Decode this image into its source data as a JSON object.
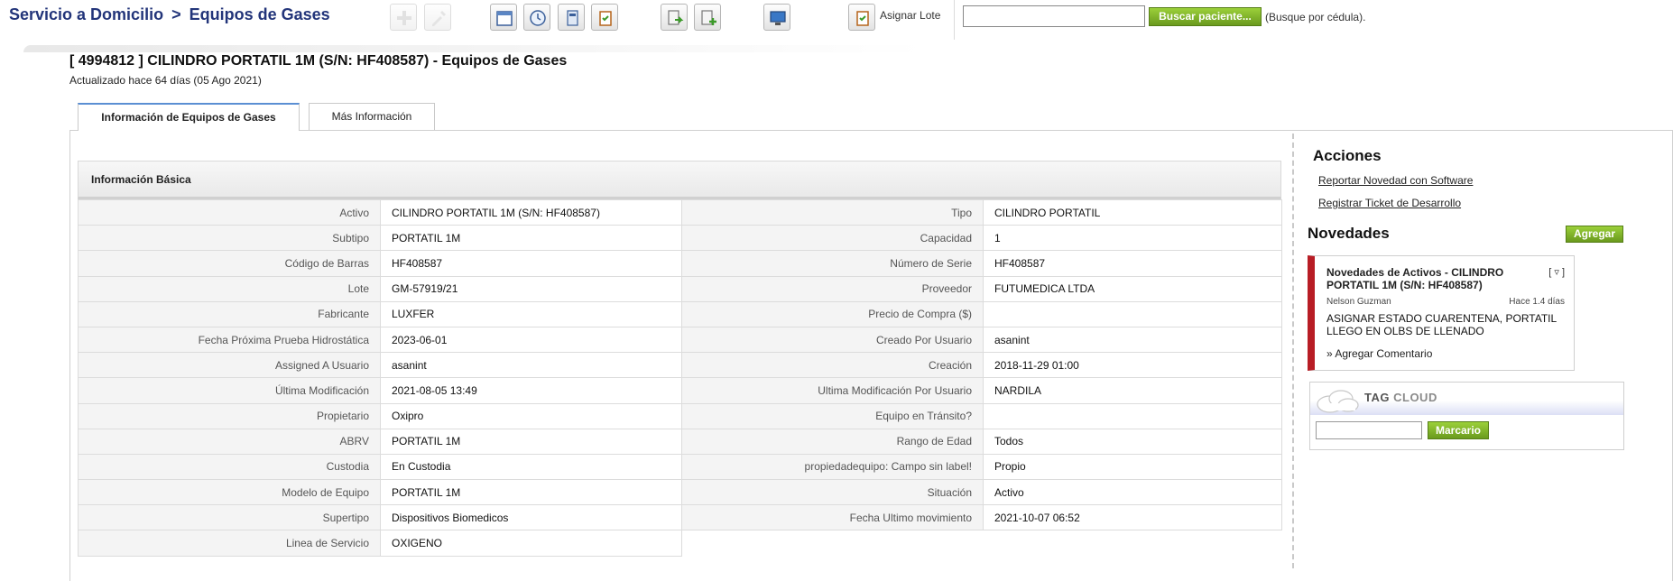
{
  "header": {
    "breadcrumb_root": "Servicio a Domicilio",
    "breadcrumb_sep": ">",
    "breadcrumb_current": "Equipos de Gases"
  },
  "toolbar": {
    "icons": [
      "plus-icon",
      "wrench-icon",
      "calendar-icon",
      "clock-icon",
      "file-icon",
      "clipboard-icon",
      "document-export-icon",
      "document-add-icon",
      "monitor-icon",
      "clipboard-check-icon"
    ],
    "asignar_lote_label": "Asignar Lote"
  },
  "search": {
    "value": "",
    "button_label": "Buscar paciente...",
    "hint": "(Busque por cédula)."
  },
  "record": {
    "title": "[ 4994812 ] CILINDRO PORTATIL 1M (S/N: HF408587) - Equipos de Gases",
    "subtitle": "Actualizado hace 64 días (05 Ago 2021)"
  },
  "tabs": [
    {
      "label": "Información de Equipos de Gases",
      "active": true
    },
    {
      "label": "Más Información",
      "active": false
    }
  ],
  "info": {
    "section_title": "Información Básica",
    "left_rows": [
      {
        "label": "Activo",
        "value": "CILINDRO PORTATIL 1M (S/N: HF408587)"
      },
      {
        "label": "Subtipo",
        "value": "PORTATIL 1M"
      },
      {
        "label": "Código de Barras",
        "value": "HF408587"
      },
      {
        "label": "Lote",
        "value": "GM-57919/21"
      },
      {
        "label": "Fabricante",
        "value": "LUXFER"
      },
      {
        "label": "Fecha Próxima Prueba Hidrostática",
        "value": "2023-06-01"
      },
      {
        "label": "Assigned A Usuario",
        "value": "asanint"
      },
      {
        "label": "Última Modificación",
        "value": "2021-08-05 13:49"
      },
      {
        "label": "Propietario",
        "value": "Oxipro"
      },
      {
        "label": "ABRV",
        "value": "PORTATIL 1M"
      },
      {
        "label": "Custodia",
        "value": "En Custodia"
      },
      {
        "label": "Modelo de Equipo",
        "value": "PORTATIL 1M"
      },
      {
        "label": "Supertipo",
        "value": "Dispositivos Biomedicos"
      },
      {
        "label": "Linea de Servicio",
        "value": "OXIGENO"
      }
    ],
    "right_rows": [
      {
        "label": "Tipo",
        "value": "CILINDRO PORTATIL"
      },
      {
        "label": "Capacidad",
        "value": "1"
      },
      {
        "label": "Número de Serie",
        "value": "HF408587"
      },
      {
        "label": "Proveedor",
        "value": "FUTUMEDICA LTDA"
      },
      {
        "label": "Precio de Compra ($)",
        "value": ""
      },
      {
        "label": "Creado Por Usuario",
        "value": "asanint"
      },
      {
        "label": "Creación",
        "value": "2018-11-29 01:00"
      },
      {
        "label": "Ultima Modificación Por Usuario",
        "value": "NARDILA"
      },
      {
        "label": "Equipo en Tránsito?",
        "value": ""
      },
      {
        "label": "Rango de Edad",
        "value": "Todos"
      },
      {
        "label": "propiedadequipo: Campo sin label!",
        "value": "Propio"
      },
      {
        "label": "Situación",
        "value": "Activo"
      },
      {
        "label": "Fecha Ultimo movimiento",
        "value": "2021-10-07 06:52"
      }
    ]
  },
  "sidebar": {
    "acciones_title": "Acciones",
    "link_reportar": "Reportar Novedad con Software",
    "link_registrar": "Registrar Ticket de Desarrollo",
    "novedades_title": "Novedades",
    "agregar_label": "Agregar",
    "novedad": {
      "title": "Novedades de Activos - CILINDRO PORTATIL 1M (S/N: HF408587)",
      "toggle": "[ ▿ ]",
      "author": "Nelson Guzman",
      "time": "Hace 1.4 días",
      "body": "ASIGNAR ESTADO CUARENTENA, PORTATIL LLEGO EN OLBS DE LLENADO",
      "comment_link": "» Agregar Comentario"
    },
    "tag_cloud": {
      "title_tag": "TAG",
      "title_cloud": "CLOUD",
      "input_value": "",
      "button_label": "Marcario"
    }
  },
  "colors": {
    "breadcrumb": "#23357a",
    "accent_green": "#7cb02c",
    "novedad_border": "#b81d25",
    "tab_active_border": "#5b8fd3"
  }
}
